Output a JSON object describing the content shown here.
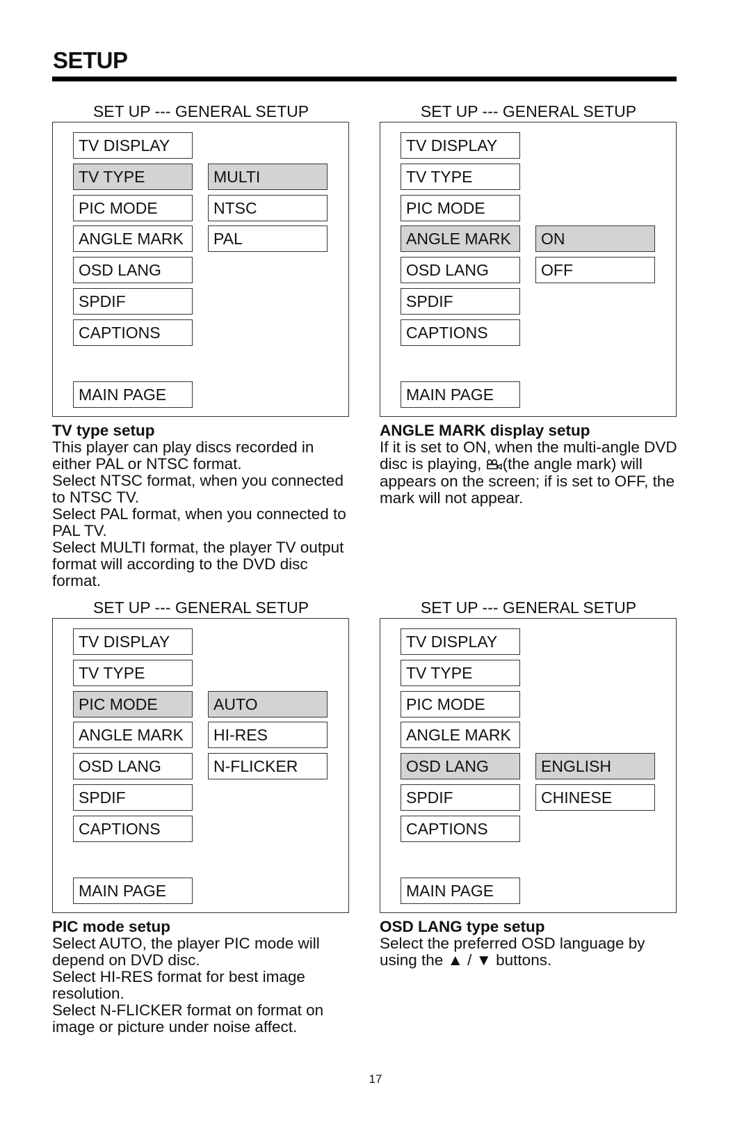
{
  "page": {
    "title": "SETUP",
    "page_number": "17"
  },
  "panels": [
    {
      "caption": "SET UP --- GENERAL SETUP",
      "menu": [
        "TV DISPLAY",
        "TV TYPE",
        "PIC MODE",
        "ANGLE MARK",
        "OSD LANG",
        "SPDIF",
        "CAPTIONS"
      ],
      "main_page": "MAIN PAGE",
      "selected_menu": "TV TYPE",
      "options": [
        "MULTI",
        "NTSC",
        "PAL"
      ],
      "selected_option": "MULTI",
      "description": {
        "title": "TV type setup",
        "lines": [
          "This player can play discs recorded in either PAL or NTSC format.",
          "Select NTSC format, when you connected to NTSC TV.",
          "Select PAL format, when you connected to PAL TV.",
          "Select MULTI format, the player TV output format will according to the DVD disc format."
        ]
      }
    },
    {
      "caption": "SET UP --- GENERAL SETUP",
      "menu": [
        "TV DISPLAY",
        "TV TYPE",
        "PIC MODE",
        "ANGLE MARK",
        "OSD LANG",
        "SPDIF",
        "CAPTIONS"
      ],
      "main_page": "MAIN PAGE",
      "selected_menu": "ANGLE MARK",
      "options": [
        "ON",
        "OFF"
      ],
      "selected_option": "ON",
      "description": {
        "title": "ANGLE MARK display setup",
        "text_before_icon": "If it is set to ON, when the multi-angle DVD disc is playing, ",
        "icon": "angle-mark-icon",
        "text_after_icon": "(the angle mark) will appears on the screen; if is set to OFF, the mark will not appear."
      }
    },
    {
      "caption": "SET UP --- GENERAL SETUP",
      "menu": [
        "TV DISPLAY",
        "TV TYPE",
        "PIC MODE",
        "ANGLE MARK",
        "OSD LANG",
        "SPDIF",
        "CAPTIONS"
      ],
      "main_page": "MAIN PAGE",
      "selected_menu": "PIC MODE",
      "options": [
        "AUTO",
        "HI-RES",
        "N-FLICKER"
      ],
      "selected_option": "AUTO",
      "description": {
        "title": "PIC mode setup",
        "lines": [
          "Select AUTO, the player PIC mode will depend on DVD disc.",
          "Select HI-RES format for best image resolution.",
          "Select N-FLICKER format on format on image or picture under noise affect."
        ]
      }
    },
    {
      "caption": "SET UP --- GENERAL SETUP",
      "menu": [
        "TV DISPLAY",
        "TV TYPE",
        "PIC MODE",
        "ANGLE MARK",
        "OSD LANG",
        "SPDIF",
        "CAPTIONS"
      ],
      "main_page": "MAIN PAGE",
      "selected_menu": "OSD LANG",
      "options": [
        "ENGLISH",
        "CHINESE"
      ],
      "selected_option": "ENGLISH",
      "description": {
        "title": "OSD LANG type setup",
        "text_before_icons": "Select the preferred OSD language by using the ",
        "up_glyph": "▲",
        "separator": " / ",
        "down_glyph": "▼",
        "text_after_icons": " buttons."
      }
    }
  ],
  "colors": {
    "selected_fill": "#d3d3d3",
    "border": "#333333",
    "text": "#111111"
  }
}
